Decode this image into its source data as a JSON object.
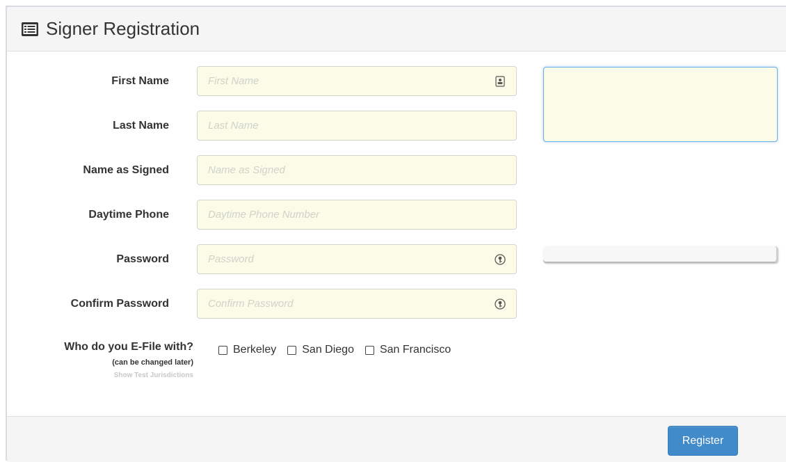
{
  "header": {
    "title": "Signer Registration",
    "icon": "list-alt-icon"
  },
  "form": {
    "fields": [
      {
        "label": "First Name",
        "placeholder": "First Name",
        "value": "",
        "icon": "contact-card-icon"
      },
      {
        "label": "Last Name",
        "placeholder": "Last Name",
        "value": ""
      },
      {
        "label": "Name as Signed",
        "placeholder": "Name as Signed",
        "value": ""
      },
      {
        "label": "Daytime Phone",
        "placeholder": "Daytime Phone Number",
        "value": ""
      },
      {
        "label": "Password",
        "placeholder": "Password",
        "value": "",
        "icon": "password-key-icon"
      },
      {
        "label": "Confirm Password",
        "placeholder": "Confirm Password",
        "value": "",
        "icon": "password-key-icon"
      }
    ]
  },
  "efile": {
    "question": "Who do you E-File with?",
    "note": "(can be changed later)",
    "test_link": "Show Test Jurisdictions",
    "options": [
      {
        "label": "Berkeley",
        "checked": false
      },
      {
        "label": "San Diego",
        "checked": false
      },
      {
        "label": "San Francisco",
        "checked": false
      }
    ]
  },
  "footer": {
    "register_label": "Register"
  },
  "colors": {
    "input_bg": "#fbfbe8",
    "primary_button": "#428bca",
    "focus_border": "#66afe9"
  }
}
